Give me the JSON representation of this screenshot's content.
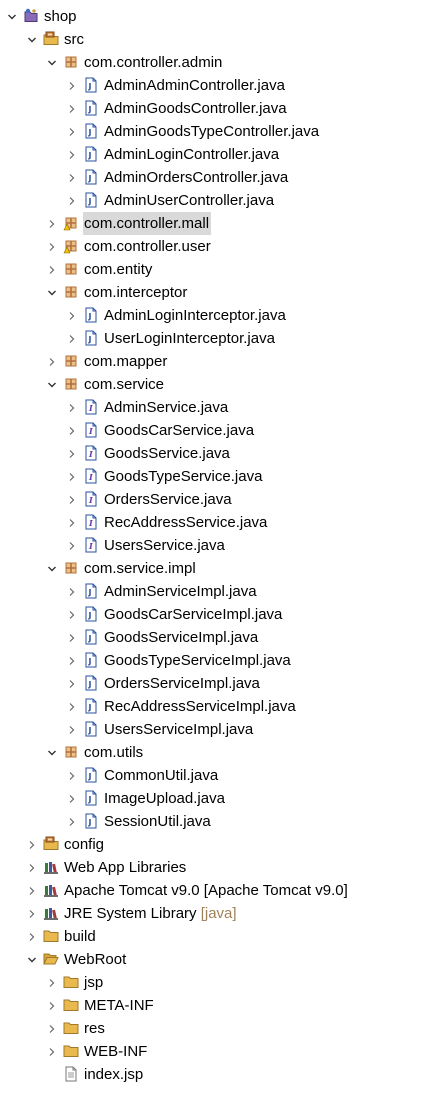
{
  "tree": [
    {
      "depth": 0,
      "chev": "open",
      "icon": "project-icon",
      "name": "project-shop",
      "label": "shop"
    },
    {
      "depth": 1,
      "chev": "open",
      "icon": "source-folder-icon",
      "name": "folder-src",
      "label": "src"
    },
    {
      "depth": 2,
      "chev": "open",
      "icon": "package-icon",
      "name": "package-com-controller-admin",
      "label": "com.controller.admin"
    },
    {
      "depth": 3,
      "chev": "closed",
      "icon": "java-class-icon",
      "name": "file-AdminAdminController",
      "label": "AdminAdminController.java"
    },
    {
      "depth": 3,
      "chev": "closed",
      "icon": "java-class-icon",
      "name": "file-AdminGoodsController",
      "label": "AdminGoodsController.java"
    },
    {
      "depth": 3,
      "chev": "closed",
      "icon": "java-class-icon",
      "name": "file-AdminGoodsTypeController",
      "label": "AdminGoodsTypeController.java"
    },
    {
      "depth": 3,
      "chev": "closed",
      "icon": "java-class-icon",
      "name": "file-AdminLoginController",
      "label": "AdminLoginController.java"
    },
    {
      "depth": 3,
      "chev": "closed",
      "icon": "java-class-icon",
      "name": "file-AdminOrdersController",
      "label": "AdminOrdersController.java"
    },
    {
      "depth": 3,
      "chev": "closed",
      "icon": "java-class-icon",
      "name": "file-AdminUserController",
      "label": "AdminUserController.java"
    },
    {
      "depth": 2,
      "chev": "closed",
      "icon": "package-warning-icon",
      "name": "package-com-controller-mall",
      "label": "com.controller.mall",
      "selected": true
    },
    {
      "depth": 2,
      "chev": "closed",
      "icon": "package-warning-icon",
      "name": "package-com-controller-user",
      "label": "com.controller.user"
    },
    {
      "depth": 2,
      "chev": "closed",
      "icon": "package-icon",
      "name": "package-com-entity",
      "label": "com.entity"
    },
    {
      "depth": 2,
      "chev": "open",
      "icon": "package-icon",
      "name": "package-com-interceptor",
      "label": "com.interceptor"
    },
    {
      "depth": 3,
      "chev": "closed",
      "icon": "java-class-icon",
      "name": "file-AdminLoginInterceptor",
      "label": "AdminLoginInterceptor.java"
    },
    {
      "depth": 3,
      "chev": "closed",
      "icon": "java-class-icon",
      "name": "file-UserLoginInterceptor",
      "label": "UserLoginInterceptor.java"
    },
    {
      "depth": 2,
      "chev": "closed",
      "icon": "package-icon",
      "name": "package-com-mapper",
      "label": "com.mapper"
    },
    {
      "depth": 2,
      "chev": "open",
      "icon": "package-icon",
      "name": "package-com-service",
      "label": "com.service"
    },
    {
      "depth": 3,
      "chev": "closed",
      "icon": "java-interface-icon",
      "name": "file-AdminService",
      "label": "AdminService.java"
    },
    {
      "depth": 3,
      "chev": "closed",
      "icon": "java-interface-icon",
      "name": "file-GoodsCarService",
      "label": "GoodsCarService.java"
    },
    {
      "depth": 3,
      "chev": "closed",
      "icon": "java-interface-icon",
      "name": "file-GoodsService",
      "label": "GoodsService.java"
    },
    {
      "depth": 3,
      "chev": "closed",
      "icon": "java-interface-icon",
      "name": "file-GoodsTypeService",
      "label": "GoodsTypeService.java"
    },
    {
      "depth": 3,
      "chev": "closed",
      "icon": "java-interface-icon",
      "name": "file-OrdersService",
      "label": "OrdersService.java"
    },
    {
      "depth": 3,
      "chev": "closed",
      "icon": "java-interface-icon",
      "name": "file-RecAddressService",
      "label": "RecAddressService.java"
    },
    {
      "depth": 3,
      "chev": "closed",
      "icon": "java-interface-icon",
      "name": "file-UsersService",
      "label": "UsersService.java"
    },
    {
      "depth": 2,
      "chev": "open",
      "icon": "package-icon",
      "name": "package-com-service-impl",
      "label": "com.service.impl"
    },
    {
      "depth": 3,
      "chev": "closed",
      "icon": "java-class-icon",
      "name": "file-AdminServiceImpl",
      "label": "AdminServiceImpl.java"
    },
    {
      "depth": 3,
      "chev": "closed",
      "icon": "java-class-icon",
      "name": "file-GoodsCarServiceImpl",
      "label": "GoodsCarServiceImpl.java"
    },
    {
      "depth": 3,
      "chev": "closed",
      "icon": "java-class-icon",
      "name": "file-GoodsServiceImpl",
      "label": "GoodsServiceImpl.java"
    },
    {
      "depth": 3,
      "chev": "closed",
      "icon": "java-class-icon",
      "name": "file-GoodsTypeServiceImpl",
      "label": "GoodsTypeServiceImpl.java"
    },
    {
      "depth": 3,
      "chev": "closed",
      "icon": "java-class-icon",
      "name": "file-OrdersServiceImpl",
      "label": "OrdersServiceImpl.java"
    },
    {
      "depth": 3,
      "chev": "closed",
      "icon": "java-class-icon",
      "name": "file-RecAddressServiceImpl",
      "label": "RecAddressServiceImpl.java"
    },
    {
      "depth": 3,
      "chev": "closed",
      "icon": "java-class-icon",
      "name": "file-UsersServiceImpl",
      "label": "UsersServiceImpl.java"
    },
    {
      "depth": 2,
      "chev": "open",
      "icon": "package-icon",
      "name": "package-com-utils",
      "label": "com.utils"
    },
    {
      "depth": 3,
      "chev": "closed",
      "icon": "java-class-icon",
      "name": "file-CommonUtil",
      "label": "CommonUtil.java"
    },
    {
      "depth": 3,
      "chev": "closed",
      "icon": "java-class-icon",
      "name": "file-ImageUpload",
      "label": "ImageUpload.java"
    },
    {
      "depth": 3,
      "chev": "closed",
      "icon": "java-class-icon",
      "name": "file-SessionUtil",
      "label": "SessionUtil.java"
    },
    {
      "depth": 1,
      "chev": "closed",
      "icon": "source-folder-icon",
      "name": "folder-config",
      "label": "config"
    },
    {
      "depth": 1,
      "chev": "closed",
      "icon": "library-icon",
      "name": "library-web-app",
      "label": "Web App Libraries"
    },
    {
      "depth": 1,
      "chev": "closed",
      "icon": "library-icon",
      "name": "library-tomcat",
      "label": "Apache Tomcat v9.0 [Apache Tomcat v9.0]"
    },
    {
      "depth": 1,
      "chev": "closed",
      "icon": "library-icon",
      "name": "library-jre",
      "label": "JRE System Library",
      "decoration": "[java]"
    },
    {
      "depth": 1,
      "chev": "closed",
      "icon": "folder-icon",
      "name": "folder-build",
      "label": "build"
    },
    {
      "depth": 1,
      "chev": "open",
      "icon": "folder-open-icon",
      "name": "folder-WebRoot",
      "label": "WebRoot"
    },
    {
      "depth": 2,
      "chev": "closed",
      "icon": "folder-icon",
      "name": "folder-jsp",
      "label": "jsp"
    },
    {
      "depth": 2,
      "chev": "closed",
      "icon": "folder-icon",
      "name": "folder-META-INF",
      "label": "META-INF"
    },
    {
      "depth": 2,
      "chev": "closed",
      "icon": "folder-icon",
      "name": "folder-res",
      "label": "res"
    },
    {
      "depth": 2,
      "chev": "closed",
      "icon": "folder-icon",
      "name": "folder-WEB-INF",
      "label": "WEB-INF"
    },
    {
      "depth": 2,
      "chev": "none",
      "icon": "file-icon",
      "name": "file-index-jsp",
      "label": "index.jsp"
    }
  ],
  "colors": {
    "selection": "#d9d9d9",
    "package": "#b5703a",
    "java_class": "#2a4f9e",
    "folder": "#e9b94d",
    "decoration": "#a0815a"
  }
}
